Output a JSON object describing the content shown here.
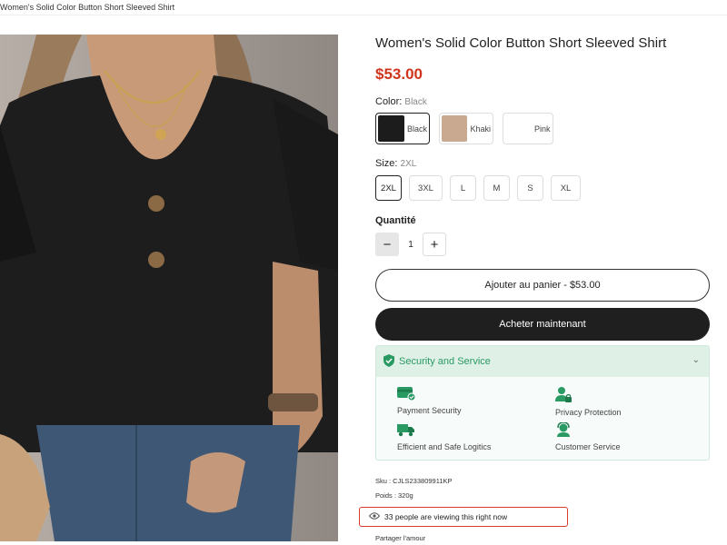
{
  "breadcrumb": "Women's Solid Color Button Short Sleeved Shirt",
  "product": {
    "title": "Women's Solid Color Button Short Sleeved Shirt",
    "price": "$53.00"
  },
  "color": {
    "label": "Color:",
    "selected": "Black",
    "options": [
      {
        "name": "Black",
        "swatch": "#1c1c1c"
      },
      {
        "name": "Khaki",
        "swatch": "#c9a98f"
      },
      {
        "name": "Pink",
        "swatch": "#ffffff"
      }
    ]
  },
  "size": {
    "label": "Size:",
    "selected": "2XL",
    "options": [
      "2XL",
      "3XL",
      "L",
      "M",
      "S",
      "XL"
    ]
  },
  "quantity": {
    "label": "Quantité",
    "minus": "−",
    "value": "1",
    "plus": "+"
  },
  "buttons": {
    "add_to_cart": "Ajouter au panier  -  $53.00",
    "buy_now": "Acheter maintenant"
  },
  "security": {
    "heading": "Security and Service",
    "items": [
      {
        "label": "Payment Security",
        "icon": "card-check-icon"
      },
      {
        "label": "Privacy Protection",
        "icon": "user-lock-icon"
      },
      {
        "label": "Efficient and Safe Logitics",
        "icon": "truck-icon"
      },
      {
        "label": "Customer Service",
        "icon": "headset-icon"
      }
    ],
    "accent": "#2a9a63"
  },
  "meta": {
    "sku": "Sku : CJLS233809911KP",
    "poids": "Poids : 320g",
    "viewing": "33 people are viewing this right now",
    "share": "Partager l'amour"
  },
  "colors": {
    "price": "#d0341c",
    "highlight": "#d93a2b",
    "buy_button": "#1f1f1f"
  }
}
